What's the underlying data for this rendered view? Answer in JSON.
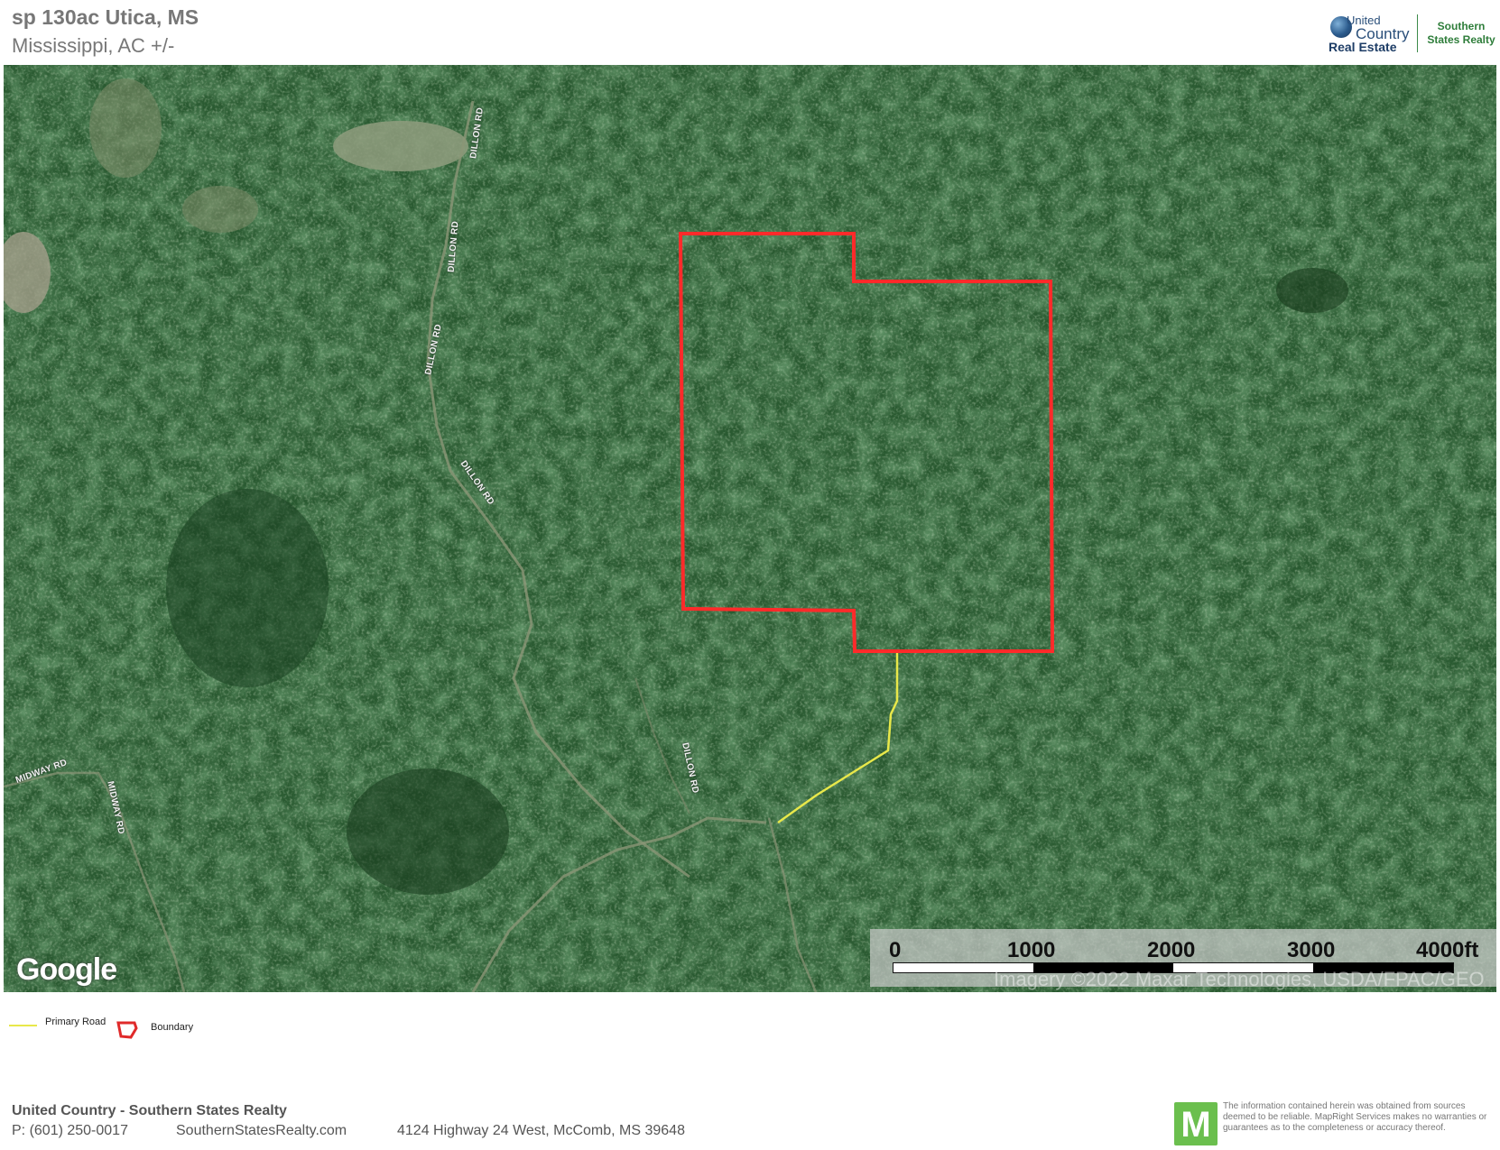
{
  "header": {
    "title": "sp 130ac Utica, MS",
    "subtitle": "Mississippi,  AC +/-"
  },
  "logo": {
    "united": "United",
    "country": "Country",
    "real_estate": "Real Estate",
    "southern": "Southern",
    "states_realty": "States Realty"
  },
  "map": {
    "road_labels": [
      "DILLON RD",
      "DILLON RD",
      "DILLON RD",
      "DILLON RD",
      "DILLON RD",
      "MIDWAY RD",
      "MIDWAY RD"
    ],
    "google_logo": "Google",
    "attribution": "Imagery ©2022 Maxar Technologies, USDA/FPAC/GEO",
    "scale": {
      "labels": [
        "0",
        "1000",
        "2000",
        "3000",
        "4000ft"
      ],
      "fraction_per_segment": 0.25
    },
    "colors": {
      "boundary": "#ff2a2a",
      "primary_road": "#e8e84a",
      "forest": "#23502b"
    }
  },
  "legend": {
    "primary_road": "Primary Road",
    "boundary": "Boundary"
  },
  "footer": {
    "company": "United Country - Southern States Realty",
    "phone": "P: (601) 250-0017",
    "website": "SouthernStatesRealty.com",
    "address": "4124 Highway 24 West, McComb, MS 39648",
    "mapright_logo": "M",
    "disclaimer": "The information contained herein was obtained from sources deemed to be reliable. MapRight Services makes no warranties or guarantees as to the completeness or accuracy thereof."
  }
}
